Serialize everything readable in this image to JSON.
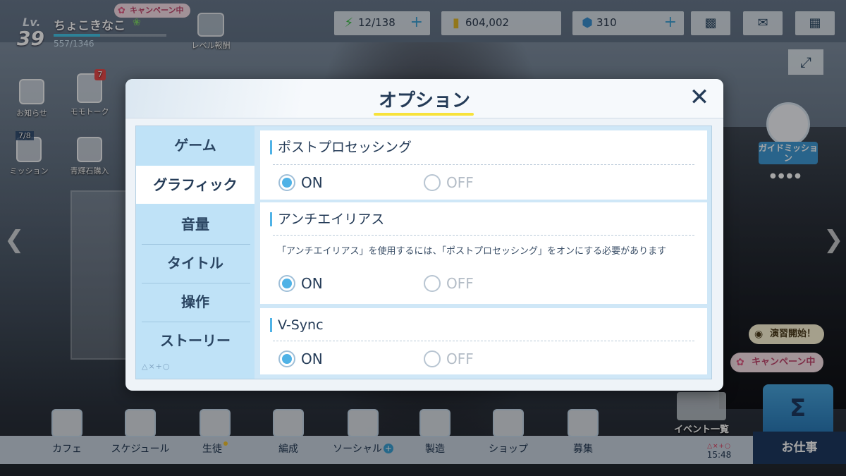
{
  "player": {
    "lv_label": "Lv.",
    "level": "39",
    "name": "ちょこきなこ",
    "exp": "557/1346",
    "exp_fraction": 0.41
  },
  "hud": {
    "campaign_label": "キャンペーン中",
    "level_reward_label": "レベル報酬",
    "ap": "12/138",
    "credits": "604,002",
    "gems": "310"
  },
  "side_menu": {
    "notice_label": "お知らせ",
    "momotalk_label": "モモトーク",
    "momotalk_badge": "7",
    "mission_label": "ミッション",
    "mission_count": "7/8",
    "gem_shop_label": "青輝石購入"
  },
  "right_panel": {
    "guide_label": "ガイドミッション",
    "practice_label": "演習開始！",
    "campaign_label": "キャンペーン中",
    "event_list_label": "イベント一覧",
    "work_label": "お仕事"
  },
  "bottom_nav": {
    "cafe": "カフェ",
    "schedule": "スケジュール",
    "students": "生徒",
    "formation": "編成",
    "social": "ソーシャル",
    "crafting": "製造",
    "shop": "ショップ",
    "recruit": "募集",
    "clock_symbols": "△×+○",
    "time": "15:48"
  },
  "modal": {
    "title": "オプション",
    "tabs": [
      {
        "label": "ゲーム"
      },
      {
        "label": "グラフィック"
      },
      {
        "label": "音量"
      },
      {
        "label": "タイトル"
      },
      {
        "label": "操作"
      },
      {
        "label": "ストーリー"
      }
    ],
    "tab_footer": "△×+○",
    "sections": [
      {
        "title": "ポストプロセッシング",
        "on_label": "ON",
        "off_label": "OFF",
        "selected": "ON"
      },
      {
        "title": "アンチエイリアス",
        "note": "「アンチエイリアス」を使用するには、「ポストプロセッシング」をオンにする必要があります",
        "on_label": "ON",
        "off_label": "OFF",
        "selected": "ON"
      },
      {
        "title": "V-Sync",
        "on_label": "ON",
        "off_label": "OFF",
        "selected": "ON"
      }
    ]
  },
  "colors": {
    "accent": "#4fb2e6",
    "title_underline": "#f7e23a",
    "tab_bg": "#bfe2f7",
    "text_dark": "#243b57"
  }
}
